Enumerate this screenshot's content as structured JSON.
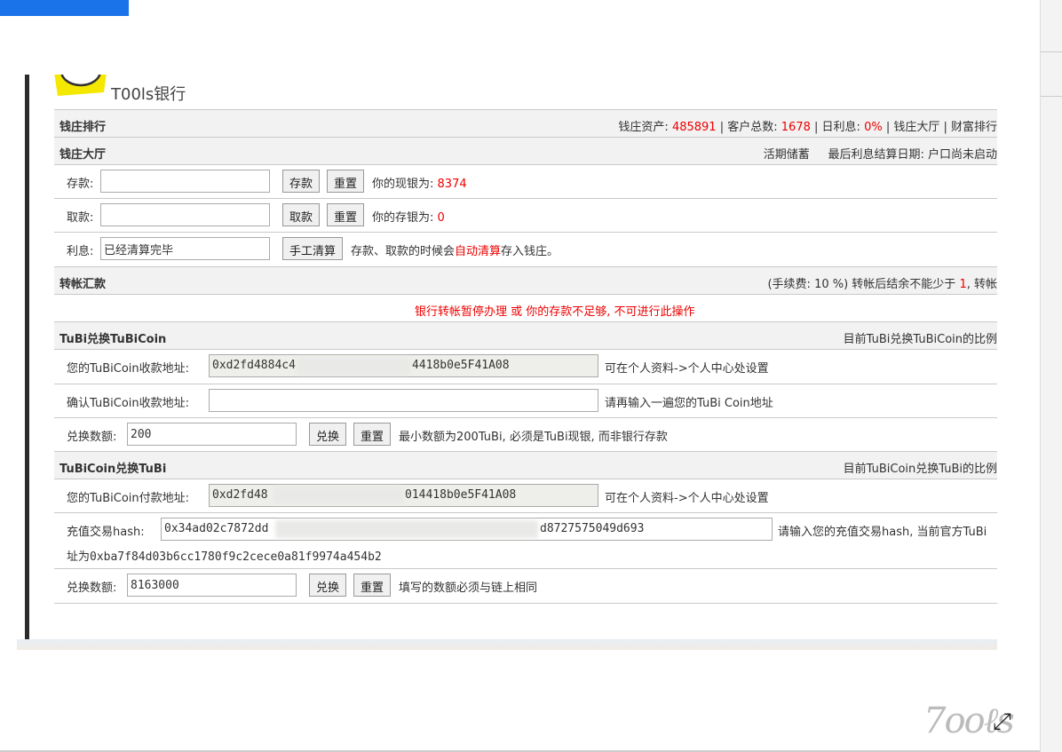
{
  "bank_title": "T00ls银行",
  "rank": {
    "title": "钱庄排行",
    "assets_label": "钱庄资产:",
    "assets": "485891",
    "customers_label": "| 客户总数:",
    "customers": "1678",
    "interest_label": "| 日利息:",
    "interest": "0%",
    "links": "| 钱庄大厅 | 财富排行"
  },
  "hall": {
    "title": "钱庄大厅",
    "savings_type": "活期储蓄",
    "last_interest": "最后利息结算日期: 户口尚未启动"
  },
  "deposit": {
    "label": "存款:",
    "value": "",
    "button": "存款",
    "reset": "重置",
    "cash_label": "你的现银为:",
    "cash": "8374"
  },
  "withdraw": {
    "label": "取款:",
    "value": "",
    "button": "取款",
    "reset": "重置",
    "saved_label": "你的存银为:",
    "saved": "0"
  },
  "interest_row": {
    "label": "利息:",
    "value": "已经清算完毕",
    "button": "手工清算",
    "note_a": "存款、取款的时候会",
    "note_b": "自动清算",
    "note_c": "存入钱庄。"
  },
  "transfer": {
    "title": "转帐汇款",
    "fee_a": "(手续费: 10 %) 转帐后结余不能少于",
    "fee_min": "1",
    "fee_b": ", 转帐",
    "notice": "银行转帐暂停办理 或 你的存款不足够, 不可进行此操作"
  },
  "tubi_to_coin": {
    "title": "TuBi兑换TuBiCoin",
    "rate": "目前TuBi兑换TuBiCoin的比例",
    "addr_label": "您的TuBiCoin收款地址:",
    "addr_a": "0xd2fd4884c4",
    "addr_b": "4418b0e5F41A08",
    "addr_note": "可在个人资料->个人中心处设置",
    "confirm_label": "确认TuBiCoin收款地址:",
    "confirm_value": "",
    "confirm_note": "请再输入一遍您的TuBi Coin地址",
    "amount_label": "兑换数额:",
    "amount": "200",
    "button": "兑换",
    "reset": "重置",
    "amount_note": "最小数额为200TuBi, 必须是TuBi现银, 而非银行存款"
  },
  "coin_to_tubi": {
    "title": "TuBiCoin兑换TuBi",
    "rate": "目前TuBiCoin兑换TuBi的比例",
    "addr_label": "您的TuBiCoin付款地址:",
    "addr_a": "0xd2fd48",
    "addr_b": "014418b0e5F41A08",
    "addr_note": "可在个人资料->个人中心处设置",
    "hash_label": "充值交易hash:",
    "hash_a": "0x34ad02c7872dd",
    "hash_b": "d8727575049d693",
    "hash_note": "请输入您的充值交易hash, 当前官方TuBi",
    "hash_note2": "址为0xba7f84d03b6cc1780f9c2cece0a81f9974a454b2",
    "amount_label": "兑换数额:",
    "amount": "8163000",
    "button": "兑换",
    "reset": "重置",
    "amount_note": "填写的数额必须与链上相同"
  },
  "watermark": "7ooℓs",
  "expand_icon": "expand-icon"
}
